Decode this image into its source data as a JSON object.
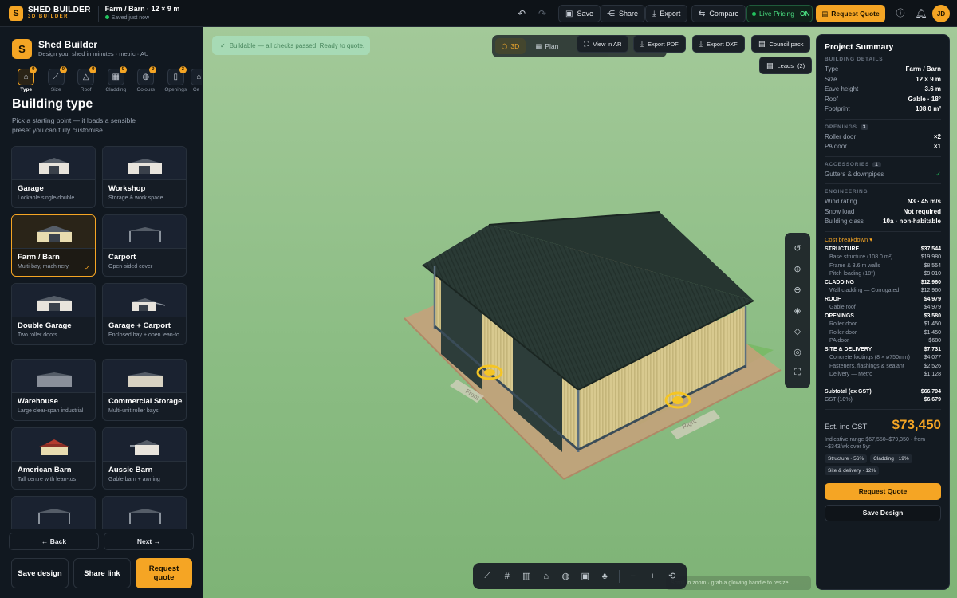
{
  "topbar": {
    "brand_line1": "SHED BUILDER",
    "brand_line2": "3D BUILDER",
    "project_title": "Farm / Barn · 12 × 9 m",
    "save_status": "Saved just now",
    "save_label": "Save",
    "share_label": "Share",
    "export_label": "Export",
    "compare_label": "Compare",
    "live_pricing_label": "Live Pricing",
    "live_pricing_state": "ON",
    "request_quote_label": "Request Quote",
    "avatar_initials": "JD"
  },
  "sidebar": {
    "title": "Shed Builder",
    "subtitle": "Design your shed in minutes · metric · AU",
    "steps": [
      {
        "label": "Type",
        "count": "0",
        "icon": "house-icon"
      },
      {
        "label": "Size",
        "count": "0",
        "icon": "ruler-icon"
      },
      {
        "label": "Roof",
        "count": "0",
        "icon": "roof-icon"
      },
      {
        "label": "Cladding",
        "count": "0",
        "icon": "cladding-icon"
      },
      {
        "label": "Colours",
        "count": "0",
        "icon": "palette-icon"
      },
      {
        "label": "Openings",
        "count": "3",
        "icon": "door-icon"
      },
      {
        "label": "Ce",
        "count": "",
        "icon": "more-icon"
      }
    ],
    "section_title": "Building type",
    "section_desc": "Pick a starting point — it loads a sensible preset you can fully customise.",
    "cards": [
      {
        "name": "Garage",
        "desc": "Lockable single/double"
      },
      {
        "name": "Workshop",
        "desc": "Storage & work space"
      },
      {
        "name": "Farm / Barn",
        "desc": "Multi-bay, machinery"
      },
      {
        "name": "Carport",
        "desc": "Open-sided cover"
      },
      {
        "name": "Double Garage",
        "desc": "Two roller doors"
      },
      {
        "name": "Garage + Carport",
        "desc": "Enclosed bay + open lean-to"
      },
      {
        "name": "Warehouse",
        "desc": "Large clear-span industrial"
      },
      {
        "name": "Commercial Storage",
        "desc": "Multi-unit roller bays"
      },
      {
        "name": "American Barn",
        "desc": "Tall centre with lean-tos"
      },
      {
        "name": "Aussie Barn",
        "desc": "Gable barn + awning"
      }
    ],
    "back_label": "← Back",
    "next_label": "Next →",
    "save_design_label": "Save design",
    "share_link_label": "Share link",
    "request_quote_label": "Request quote"
  },
  "viewport": {
    "toast": "Buildable — all checks passed. Ready to quote.",
    "tab_3d": "3D",
    "tab_plan": "Plan",
    "view_ar_label": "View in AR",
    "export_pdf_label": "Export PDF",
    "export_dxf_label": "Export DXF",
    "council_pack_label": "Council pack",
    "leads_label": "Leads",
    "leads_count": "(2)",
    "front_label": "Front",
    "right_label": "Right",
    "hint": "Scroll to zoom · grab a glowing handle to resize"
  },
  "summary": {
    "title": "Project Summary",
    "building_details_heading": "BUILDING DETAILS",
    "details": [
      {
        "k": "Type",
        "v": "Farm / Barn"
      },
      {
        "k": "Size",
        "v": "12 × 9 m"
      },
      {
        "k": "Eave height",
        "v": "3.6 m"
      },
      {
        "k": "Roof",
        "v": "Gable · 18°"
      },
      {
        "k": "Footprint",
        "v": "108.0 m²"
      }
    ],
    "openings_heading": "OPENINGS",
    "openings_count": "3",
    "openings": [
      {
        "k": "Roller door",
        "v": "×2"
      },
      {
        "k": "PA door",
        "v": "×1"
      }
    ],
    "accessories_heading": "ACCESSORIES",
    "accessories_count": "1",
    "accessories": [
      {
        "k": "Gutters & downpipes",
        "v": "✓"
      }
    ],
    "engineering_heading": "ENGINEERING",
    "engineering": [
      {
        "k": "Wind rating",
        "v": "N3 · 45 m/s"
      },
      {
        "k": "Snow load",
        "v": "Not required"
      },
      {
        "k": "Building class",
        "v": "10a · non-habitable"
      }
    ],
    "cost_breakdown_label": "Cost breakdown ▾",
    "cost_rows": [
      {
        "k": "STRUCTURE",
        "v": "$37,544",
        "t": "h"
      },
      {
        "k": "Base structure (108.0 m²)",
        "v": "$19,980",
        "t": "s"
      },
      {
        "k": "Frame & 3.6 m walls",
        "v": "$8,554",
        "t": "s"
      },
      {
        "k": "Pitch loading (18°)",
        "v": "$9,010",
        "t": "s"
      },
      {
        "k": "CLADDING",
        "v": "$12,960",
        "t": "h"
      },
      {
        "k": "Wall cladding — Corrugated",
        "v": "$12,960",
        "t": "s"
      },
      {
        "k": "ROOF",
        "v": "$4,979",
        "t": "h"
      },
      {
        "k": "Gable roof",
        "v": "$4,979",
        "t": "s"
      },
      {
        "k": "OPENINGS",
        "v": "$3,580",
        "t": "h"
      },
      {
        "k": "Roller door",
        "v": "$1,450",
        "t": "s"
      },
      {
        "k": "Roller door",
        "v": "$1,450",
        "t": "s"
      },
      {
        "k": "PA door",
        "v": "$680",
        "t": "s"
      },
      {
        "k": "SITE & DELIVERY",
        "v": "$7,731",
        "t": "h"
      },
      {
        "k": "Concrete footings (8 × ø750mm)",
        "v": "$4,077",
        "t": "s"
      },
      {
        "k": "Fasteners, flashings & sealant",
        "v": "$2,526",
        "t": "s"
      },
      {
        "k": "Delivery — Metro",
        "v": "$1,128",
        "t": "s"
      }
    ],
    "subtotal_label": "Subtotal (ex GST)",
    "subtotal_value": "$66,794",
    "gst_label": "GST (10%)",
    "gst_value": "$6,679",
    "est_label": "Est. inc GST",
    "est_value": "$73,450",
    "range_text": "Indicative range $67,550–$79,350 · from ~$343/wk over 5yr",
    "chips": [
      "Structure · 56%",
      "Cladding · 19%",
      "Site & delivery · 12%"
    ],
    "request_quote_label": "Request Quote",
    "save_design_label": "Save Design"
  },
  "colors": {
    "accent": "#f5a524",
    "roof": "#2a3a35",
    "wall": "#d8c98f",
    "ground": "#7eb376",
    "slab": "#c8a07a"
  }
}
